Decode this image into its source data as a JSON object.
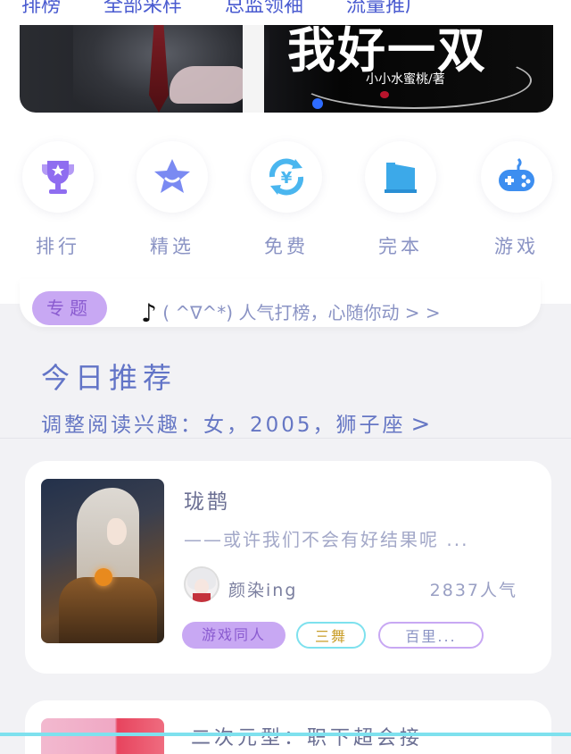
{
  "tabs": [
    "排榜",
    "全部采样",
    "总监领袖",
    "流量推广"
  ],
  "banner": {
    "title": "我好一双",
    "author": "小小水蜜桃/著"
  },
  "categories": [
    {
      "label": "排行",
      "icon": "trophy-icon",
      "color": "#8f6df0"
    },
    {
      "label": "精选",
      "icon": "star-icon",
      "color": "#7a8af2"
    },
    {
      "label": "免费",
      "icon": "yen-refresh-icon",
      "color": "#4ab6ef"
    },
    {
      "label": "完本",
      "icon": "book-icon",
      "color": "#3ca9e9"
    },
    {
      "label": "游戏",
      "icon": "gamepad-icon",
      "color": "#3d8ef0"
    }
  ],
  "topic": {
    "badge": "专题",
    "note": "♪",
    "text": "( ^∇^*) 人气打榜，心随你动 > >"
  },
  "recommend": {
    "title": "今日推荐",
    "subtitle": "调整阅读兴趣：女，2005，狮子座",
    "chevron": ">"
  },
  "book": {
    "title": "珑鹊",
    "description": "——或许我们不会有好结果呢 ...",
    "author": "颜染ing",
    "popularity": "2837人气",
    "tags": [
      "游戏同人",
      "三舞",
      "百里..."
    ]
  },
  "next_book": {
    "title": "二次元型：职下超会接"
  },
  "colors": {
    "accent_purple": "#c8a8f3",
    "accent_cyan": "#7ee1ee",
    "text_blue": "#6274c7"
  }
}
